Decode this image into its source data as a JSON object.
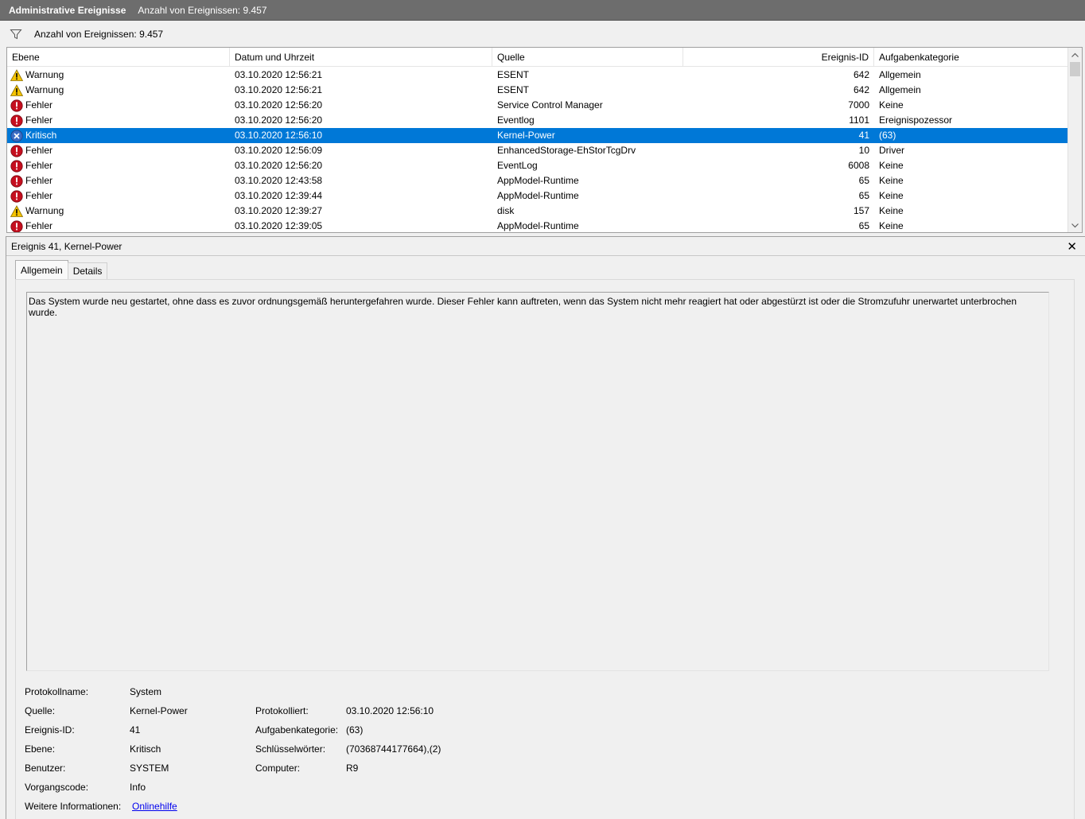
{
  "title": {
    "name": "Administrative Ereignisse",
    "count": "Anzahl von Ereignissen: 9.457"
  },
  "filter": {
    "icon": "filter-icon",
    "count": "Anzahl von Ereignissen: 9.457"
  },
  "columns": {
    "level": "Ebene",
    "date": "Datum und Uhrzeit",
    "source": "Quelle",
    "event_id": "Ereignis-ID",
    "category": "Aufgabenkategorie"
  },
  "events": [
    {
      "level": "Warnung",
      "icon": "warning-icon",
      "date": "03.10.2020 12:56:21",
      "source": "ESENT",
      "id": "642",
      "category": "Allgemein"
    },
    {
      "level": "Warnung",
      "icon": "warning-icon",
      "date": "03.10.2020 12:56:21",
      "source": "ESENT",
      "id": "642",
      "category": "Allgemein"
    },
    {
      "level": "Fehler",
      "icon": "error-icon",
      "date": "03.10.2020 12:56:20",
      "source": "Service Control Manager",
      "id": "7000",
      "category": "Keine"
    },
    {
      "level": "Fehler",
      "icon": "error-icon",
      "date": "03.10.2020 12:56:20",
      "source": "Eventlog",
      "id": "1101",
      "category": "Ereignispozessor"
    },
    {
      "level": "Kritisch",
      "icon": "critical-icon",
      "date": "03.10.2020 12:56:10",
      "source": "Kernel-Power",
      "id": "41",
      "category": "(63)"
    },
    {
      "level": "Fehler",
      "icon": "error-icon",
      "date": "03.10.2020 12:56:09",
      "source": "EnhancedStorage-EhStorTcgDrv",
      "id": "10",
      "category": "Driver"
    },
    {
      "level": "Fehler",
      "icon": "error-icon",
      "date": "03.10.2020 12:56:20",
      "source": "EventLog",
      "id": "6008",
      "category": "Keine"
    },
    {
      "level": "Fehler",
      "icon": "error-icon",
      "date": "03.10.2020 12:43:58",
      "source": "AppModel-Runtime",
      "id": "65",
      "category": "Keine"
    },
    {
      "level": "Fehler",
      "icon": "error-icon",
      "date": "03.10.2020 12:39:44",
      "source": "AppModel-Runtime",
      "id": "65",
      "category": "Keine"
    },
    {
      "level": "Warnung",
      "icon": "warning-icon",
      "date": "03.10.2020 12:39:27",
      "source": "disk",
      "id": "157",
      "category": "Keine"
    },
    {
      "level": "Fehler",
      "icon": "error-icon",
      "date": "03.10.2020 12:39:05",
      "source": "AppModel-Runtime",
      "id": "65",
      "category": "Keine"
    }
  ],
  "selected_index": 4,
  "detail": {
    "header": "Ereignis 41, Kernel-Power",
    "close": "✕",
    "tabs": [
      "Allgemein",
      "Details"
    ],
    "active_tab": 0,
    "description": "Das System wurde neu gestartet, ohne dass es zuvor ordnungsgemäß heruntergefahren wurde. Dieser Fehler kann auftreten, wenn das System nicht mehr reagiert hat oder abgestürzt ist oder die Stromzufuhr unerwartet unterbrochen wurde.",
    "props": {
      "log_name_label": "Protokollname:",
      "log_name": "System",
      "source_label": "Quelle:",
      "source": "Kernel-Power",
      "logged_label": "Protokolliert:",
      "logged": "03.10.2020 12:56:10",
      "event_id_label": "Ereignis-ID:",
      "event_id": "41",
      "task_cat_label": "Aufgabenkategorie:",
      "task_cat": "(63)",
      "level_label": "Ebene:",
      "level": "Kritisch",
      "keywords_label": "Schlüsselwörter:",
      "keywords": "(70368744177664),(2)",
      "user_label": "Benutzer:",
      "user": "SYSTEM",
      "computer_label": "Computer:",
      "computer": "R9",
      "opcode_label": "Vorgangscode:",
      "opcode": "Info",
      "more_info_label": "Weitere Informationen:",
      "more_info_link": "Onlinehilfe"
    }
  },
  "colors": {
    "titlebar": "#6d6d6d",
    "selection": "#0078d7",
    "warning": "#f5c400",
    "error": "#c50f1f",
    "critical": "#3a6cc4",
    "link": "#0000ee"
  }
}
